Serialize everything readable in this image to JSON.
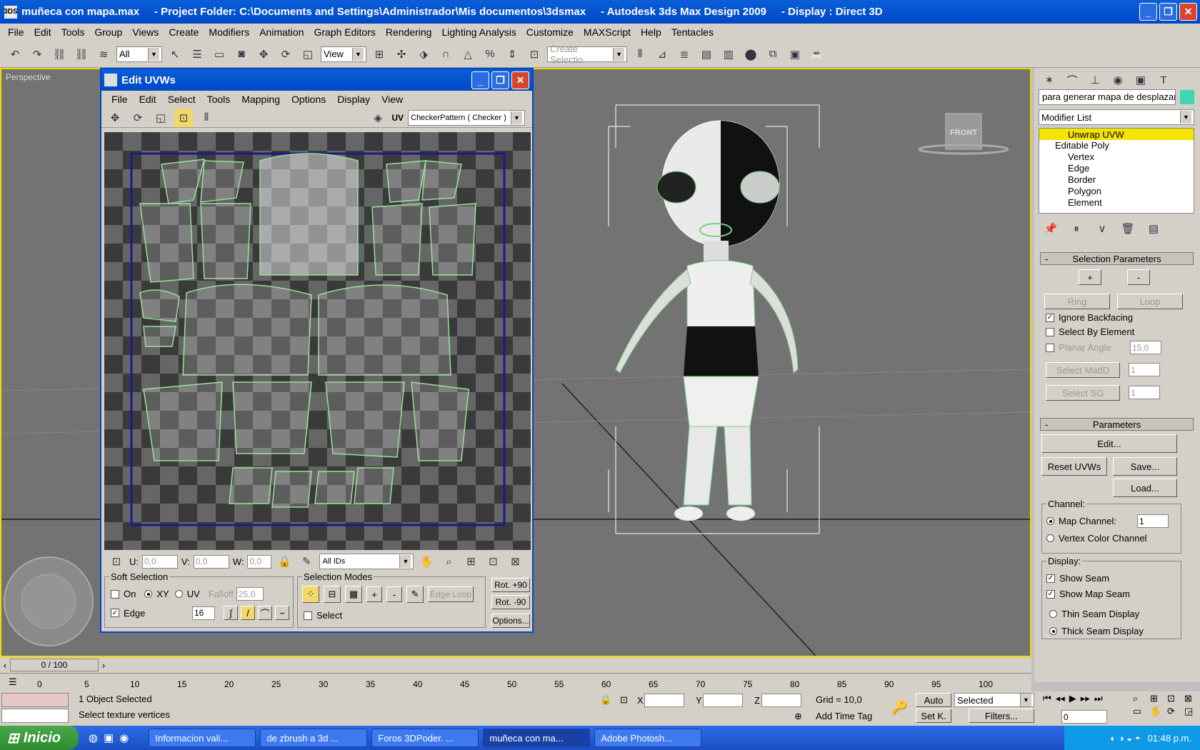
{
  "app": {
    "title": "muñeca con mapa.max     - Project Folder: C:\\Documents and Settings\\Administrador\\Mis documentos\\3dsmax     - Autodesk 3ds Max Design 2009     - Display : Direct 3D",
    "icon_text": "3DS"
  },
  "menu": [
    "File",
    "Edit",
    "Tools",
    "Group",
    "Views",
    "Create",
    "Modifiers",
    "Animation",
    "Graph Editors",
    "Rendering",
    "Lighting Analysis",
    "Customize",
    "MAXScript",
    "Help",
    "Tentacles"
  ],
  "toolbar": {
    "selection_filter": "All",
    "ref_coord": "View",
    "named_selection": "Create Selectio"
  },
  "viewport": {
    "label": "Perspective",
    "viewcube_label": "FRONT"
  },
  "uvw": {
    "title": "Edit UVWs",
    "menu": [
      "File",
      "Edit",
      "Select",
      "Tools",
      "Mapping",
      "Options",
      "Display",
      "View"
    ],
    "uv_label": "UV",
    "texture": "CheckerPattern  ( Checker )",
    "u_label": "U:",
    "u_value": "0,0",
    "v_label": "V:",
    "v_value": "0,0",
    "w_label": "W:",
    "w_value": "0,0",
    "ids": "All IDs",
    "soft_selection": {
      "title": "Soft Selection",
      "on": "On",
      "xy": "XY",
      "uv": "UV",
      "falloff": "Falloff",
      "falloff_value": "25,0",
      "edge": "Edge",
      "edge_value": "16"
    },
    "selection_modes": {
      "title": "Selection Modes",
      "edge_loop": "Edge Loop",
      "select": "Select"
    },
    "rot_plus": "Rot. +90",
    "rot_minus": "Rot. -90",
    "options": "Options..."
  },
  "cmd": {
    "object_name": "para generar mapa de desplazar",
    "modifier_list": "Modifier List",
    "stack": [
      "Unwrap UVW",
      "Editable Poly",
      "Vertex",
      "Edge",
      "Border",
      "Polygon",
      "Element"
    ],
    "selection_parameters": "Selection Parameters",
    "plus": "+",
    "minus": "-",
    "ring": "Ring",
    "loop": "Loop",
    "ignore_backfacing": "Ignore Backfacing",
    "select_by_element": "Select By Element",
    "planar_angle": "Planar Angle",
    "planar_value": "15,0",
    "select_matid": "Select MatID",
    "matid_value": "1",
    "select_sg": "Select SG",
    "sg_value": "1",
    "parameters": "Parameters",
    "edit": "Edit...",
    "reset_uvws": "Reset UVWs",
    "save": "Save...",
    "load": "Load...",
    "channel": "Channel:",
    "map_channel": "Map Channel:",
    "map_channel_value": "1",
    "vertex_color_channel": "Vertex Color Channel",
    "display": "Display:",
    "show_seam": "Show Seam",
    "show_map_seam": "Show Map Seam",
    "thin_seam": "Thin Seam Display",
    "thick_seam": "Thick Seam Display"
  },
  "timeline": {
    "frame": "0 / 100",
    "ticks": [
      "0",
      "5",
      "10",
      "15",
      "20",
      "25",
      "30",
      "35",
      "40",
      "45",
      "50",
      "55",
      "60",
      "65",
      "70",
      "75",
      "80",
      "85",
      "90",
      "95",
      "100"
    ]
  },
  "status": {
    "selected": "1 Object Selected",
    "prompt": "Select texture vertices",
    "x_label": "X",
    "y_label": "Y",
    "z_label": "Z",
    "grid": "Grid = 10,0",
    "auto": "Auto",
    "set_key": "Set K.",
    "selected_dd": "Selected",
    "filters": "Filters...",
    "add_time_tag": "Add Time Tag",
    "frame_value": "0"
  },
  "taskbar": {
    "start": "Inicio",
    "tasks": [
      "Informacion vali...",
      "de zbrush a 3d ...",
      "Foros 3DPoder. ...",
      "muñeca con ma...",
      "Adobe Photosh..."
    ],
    "time": "01:48 p.m."
  }
}
